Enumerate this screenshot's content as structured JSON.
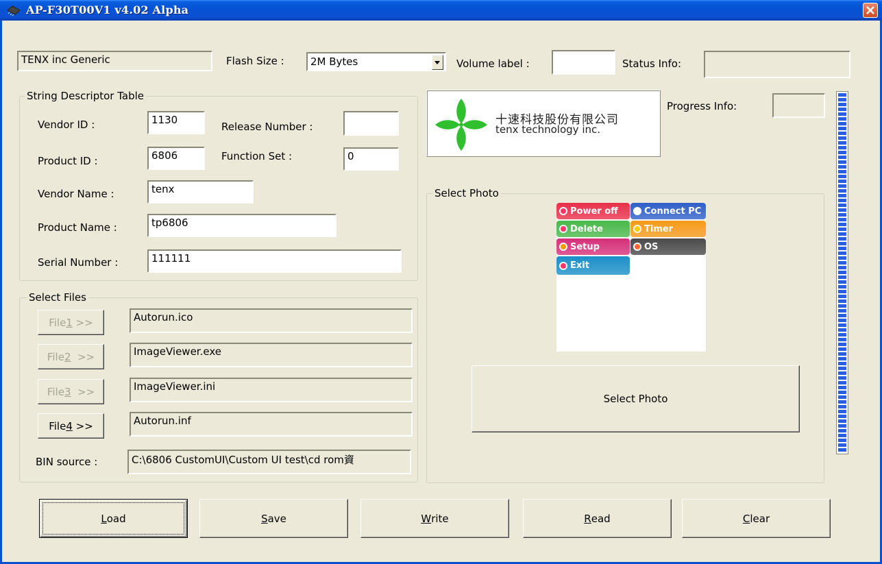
{
  "window": {
    "title": "AP-F30T00V1 v4.02 Alpha"
  },
  "top": {
    "device_name": "TENX inc Generic",
    "flash_size_label": "Flash Size :",
    "flash_size_value": "2M Bytes",
    "volume_label": "Volume label :",
    "volume_value": "",
    "status_label": "Status Info:",
    "status_value": ""
  },
  "descriptor": {
    "group_title": "String Descriptor Table",
    "vendor_id_label": "Vendor ID :",
    "vendor_id_value": "1130",
    "release_label": "Release Number :",
    "release_value": "",
    "product_id_label": "Product ID :",
    "product_id_value": "6806",
    "function_set_label": "Function Set :",
    "function_set_value": "0",
    "vendor_name_label": "Vendor Name :",
    "vendor_name_value": "tenx",
    "product_name_label": "Product Name :",
    "product_name_value": "tp6806",
    "serial_label": "Serial Number :",
    "serial_value": "111111"
  },
  "files": {
    "group_title": "Select Files",
    "items": [
      {
        "pre": "File ",
        "key": "1",
        "post": " >>",
        "value": "Autorun.ico",
        "enabled": false
      },
      {
        "pre": "File ",
        "key": "2",
        "post": "  >>",
        "value": "ImageViewer.exe",
        "enabled": false
      },
      {
        "pre": "File ",
        "key": "3",
        "post": "  >>",
        "value": "ImageViewer.ini",
        "enabled": false
      },
      {
        "pre": "File ",
        "key": "4",
        "post": " >>",
        "value": "Autorun.inf",
        "enabled": true
      }
    ],
    "bin_label": "BIN source :",
    "bin_value": "C:\\6806 CustomUI\\Custom UI test\\cd rom資"
  },
  "logo": {
    "chinese": "十速科技股份有限公司",
    "english": "tenx technology inc."
  },
  "progress": {
    "label": "Progress Info:",
    "value": "",
    "fraction": 1.0
  },
  "photo": {
    "group_title": "Select Photo",
    "menu": [
      {
        "label": "Power off",
        "color": "#e8304a",
        "icon_color": "#f36"
      },
      {
        "label": "Connect PC",
        "color": "#2f5fc8",
        "icon_color": "#fff"
      },
      {
        "label": "Delete",
        "color": "#49b84a",
        "icon_color": "#f36"
      },
      {
        "label": "Timer",
        "color": "#f59a1a",
        "icon_color": "#fc0"
      },
      {
        "label": "Setup",
        "color": "#d6307a",
        "icon_color": "#f90"
      },
      {
        "label": "OS",
        "color": "#4a4a4a",
        "icon_color": "#f63"
      },
      {
        "label": "Exit",
        "color": "#1b8fc8",
        "icon_color": "#f36"
      }
    ],
    "button_label": "Select Photo"
  },
  "actions": [
    {
      "key": "L",
      "rest": "oad",
      "name": "load-button"
    },
    {
      "key": "S",
      "rest": "ave",
      "name": "save-button"
    },
    {
      "key": "W",
      "rest": "rite",
      "name": "write-button"
    },
    {
      "key": "R",
      "rest": "ead",
      "name": "read-button"
    },
    {
      "key": "C",
      "rest": "lear",
      "name": "clear-button"
    }
  ],
  "colors": {
    "titlebar": "#0a50cf",
    "progress_fill": "#2a5de0",
    "face": "#ece9d8"
  }
}
